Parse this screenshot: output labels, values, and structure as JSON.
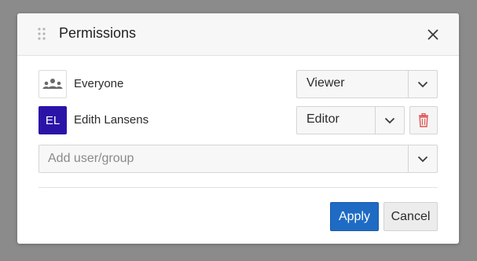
{
  "dialog": {
    "title": "Permissions",
    "icons": {
      "drag": "drag-handle-icon",
      "close": "close-icon"
    }
  },
  "permissions": [
    {
      "name": "Everyone",
      "avatar": {
        "type": "icon",
        "icon": "group-icon"
      },
      "role": "Viewer",
      "deletable": false
    },
    {
      "name": "Edith Lansens",
      "avatar": {
        "type": "initials",
        "initials": "EL",
        "color": "#2a14a8"
      },
      "role": "Editor",
      "deletable": true
    }
  ],
  "add_field": {
    "placeholder": "Add user/group"
  },
  "footer": {
    "apply_label": "Apply",
    "cancel_label": "Cancel"
  },
  "colors": {
    "primary": "#1f6bc4",
    "danger": "#e05252",
    "avatar": "#2a14a8"
  }
}
